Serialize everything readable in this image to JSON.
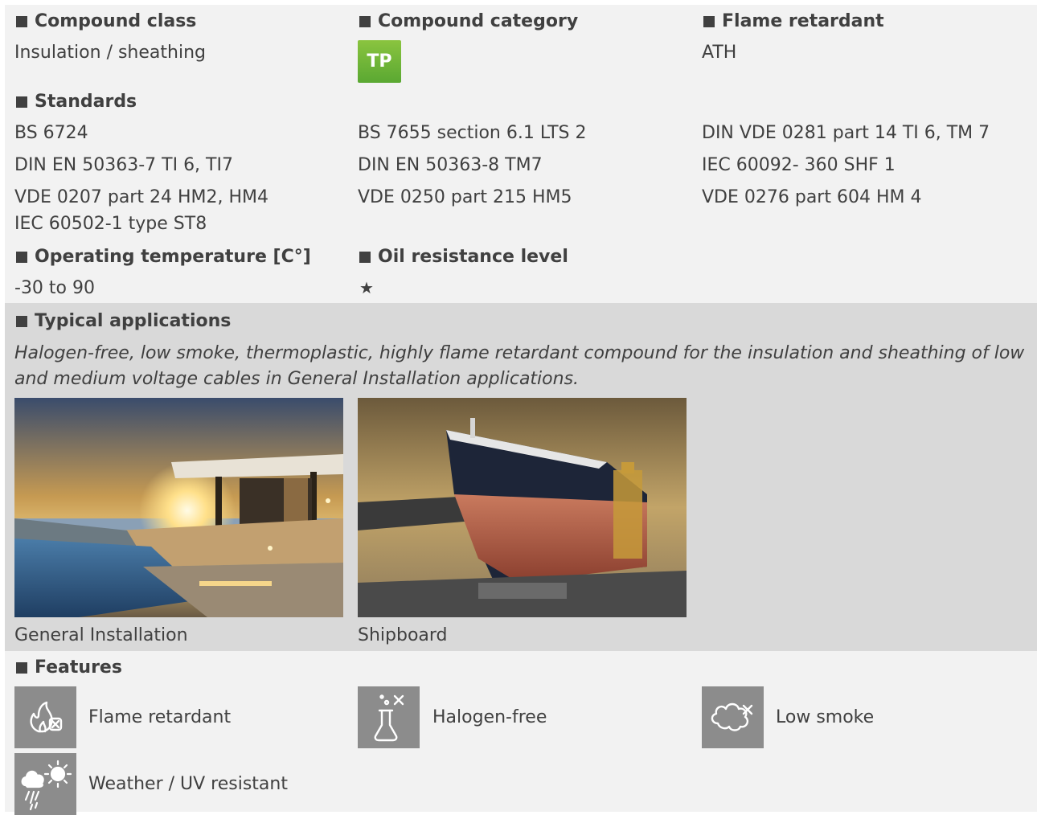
{
  "compound_class": {
    "heading": "Compound class",
    "value": "Insulation / sheathing"
  },
  "compound_category": {
    "heading": "Compound category",
    "badge": "TP",
    "badge_color": "#6cb63a"
  },
  "flame_retardant": {
    "heading": "Flame retardant",
    "value": "ATH"
  },
  "standards": {
    "heading": "Standards",
    "items": [
      "BS 6724",
      "BS 7655 section 6.1 LTS 2",
      "DIN VDE 0281 part 14 TI 6, TM 7",
      "DIN EN 50363-7 TI 6, TI7",
      "DIN EN 50363-8 TM7",
      "IEC 60092- 360 SHF 1",
      "VDE 0207 part 24 HM2, HM4",
      "VDE 0250 part 215 HM5",
      "VDE 0276 part 604 HM 4",
      "IEC 60502-1 type ST8"
    ]
  },
  "operating_temperature": {
    "heading": "Operating temperature [C°]",
    "value": "-30 to 90"
  },
  "oil_resistance": {
    "heading": "Oil resistance level",
    "value": "★"
  },
  "applications": {
    "heading": "Typical applications",
    "description": "Halogen-free, low smoke, thermoplastic, highly flame retardant compound for the insulation and sheathing of low and medium voltage cables in General Installation applications.",
    "images": [
      {
        "caption": "General Installation",
        "icon": "general-installation-photo"
      },
      {
        "caption": "Shipboard",
        "icon": "shipboard-photo"
      }
    ]
  },
  "features": {
    "heading": "Features",
    "items": [
      {
        "label": "Flame retardant",
        "icon": "flame-retardant-icon"
      },
      {
        "label": "Halogen-free",
        "icon": "halogen-free-icon"
      },
      {
        "label": "Low smoke",
        "icon": "low-smoke-icon"
      },
      {
        "label": "Weather / UV resistant",
        "icon": "weather-uv-icon"
      }
    ],
    "icon_bg": "#8c8c8c"
  }
}
